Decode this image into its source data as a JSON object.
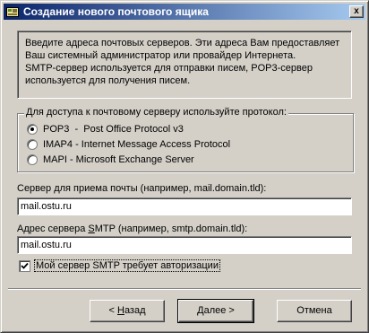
{
  "window": {
    "title": "Создание нового почтового ящика",
    "close_label": "x"
  },
  "info": {
    "text": "Введите адреса почтовых серверов. Эти адреса Вам предоставляет\nВаш системный администратор или провайдер Интернета.\nSMTP-сервер используется для отправки писем, POP3-сервер\nиспользуется для получения писем."
  },
  "protocol": {
    "legend": "Для доступа к почтовому серверу используйте протокол:",
    "options": [
      {
        "label": "POP3  -  Post Office Protocol v3",
        "checked": true
      },
      {
        "label": "IMAP4 - Internet Message Access Protocol",
        "checked": false
      },
      {
        "label": "MAPI - Microsoft Exchange Server",
        "checked": false
      }
    ]
  },
  "incoming": {
    "label": "Сервер для приема почты  (например, mail.domain.tld):",
    "value": "mail.ostu.ru"
  },
  "smtp": {
    "label_prefix": "Адрес сервера ",
    "label_accel": "S",
    "label_suffix": "MTP (например, smtp.domain.tld):",
    "value": "mail.ostu.ru"
  },
  "auth": {
    "label": "Мой сервер SMTP требует авторизации",
    "checked": true
  },
  "buttons": {
    "back_arrow": "<",
    "back_accel": "Н",
    "back_rest": "азад",
    "next_accel": "Д",
    "next_rest": "алее",
    "next_arrow": ">",
    "cancel": "Отмена"
  }
}
